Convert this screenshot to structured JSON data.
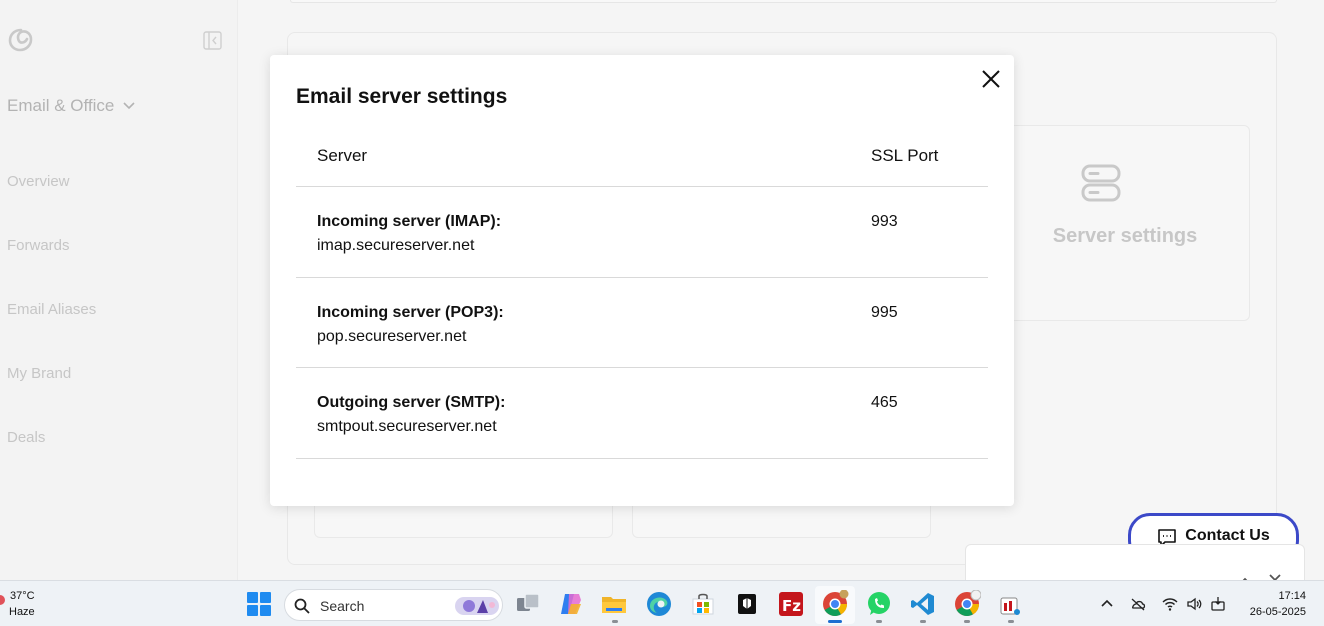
{
  "sidebar": {
    "product_switch": "Email & Office",
    "items": [
      {
        "label": "Overview"
      },
      {
        "label": "Forwards"
      },
      {
        "label": "Email Aliases"
      },
      {
        "label": "My Brand"
      },
      {
        "label": "Deals"
      }
    ]
  },
  "background_card": {
    "title": "Server settings",
    "icon": "server-icon"
  },
  "modal": {
    "title": "Email server settings",
    "columns": [
      "Server",
      "SSL Port"
    ],
    "rows": [
      {
        "label": "Incoming server (IMAP):",
        "host": "imap.secureserver.net",
        "port": "993"
      },
      {
        "label": "Incoming server (POP3):",
        "host": "pop.secureserver.net",
        "port": "995"
      },
      {
        "label": "Outgoing server (SMTP):",
        "host": "smtpout.secureserver.net",
        "port": "465"
      }
    ]
  },
  "contact": {
    "label": "Contact Us"
  },
  "taskbar": {
    "weather_temp": "37°C",
    "weather_condition": "Haze",
    "search_label": "Search",
    "time": "17:14",
    "date": "26-05-2025"
  },
  "colors": {
    "accent": "#3c49c8",
    "divider": "#d9d9d9",
    "muted_text": "#c6c6c6"
  }
}
